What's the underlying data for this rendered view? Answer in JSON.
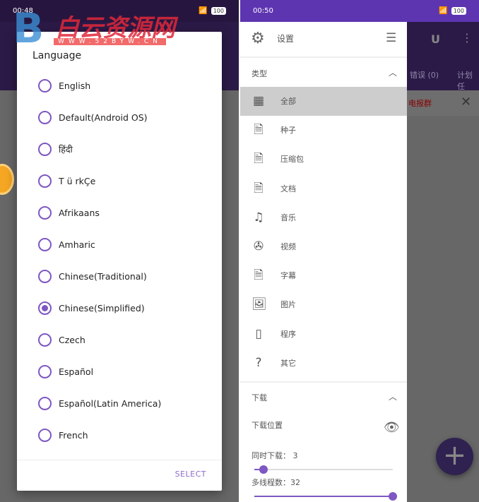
{
  "left": {
    "status": {
      "time": "00:48",
      "battery": "100"
    },
    "watermark": {
      "logo": "B",
      "title": "白云资源网",
      "url": "WWW.52BYW.CN"
    },
    "dialog": {
      "title": "Language",
      "options": [
        {
          "label": "English",
          "selected": false
        },
        {
          "label": "Default(Android OS)",
          "selected": false
        },
        {
          "label": "हिंदी",
          "selected": false
        },
        {
          "label": "T ü rkÇe",
          "selected": false
        },
        {
          "label": "Afrikaans",
          "selected": false
        },
        {
          "label": "Amharic",
          "selected": false
        },
        {
          "label": "Chinese(Traditional)",
          "selected": false
        },
        {
          "label": "Chinese(Simplified)",
          "selected": true
        },
        {
          "label": "Czech",
          "selected": false
        },
        {
          "label": "Español",
          "selected": false
        },
        {
          "label": "Español(Latin America)",
          "selected": false
        },
        {
          "label": "French",
          "selected": false
        }
      ],
      "select_label": "SELECT"
    },
    "accent": "#7e57c2"
  },
  "right": {
    "status": {
      "time": "00:50",
      "battery": "100"
    },
    "background": {
      "tab_error": "错误 (0)",
      "tab_plan": "计划任",
      "notice": "电报群"
    },
    "drawer": {
      "header": {
        "title": "设置"
      },
      "type_section": {
        "title": "类型",
        "items": [
          {
            "label": "全部",
            "icon": "grid-icon",
            "selected": true
          },
          {
            "label": "种子",
            "icon": "torrent-file-icon"
          },
          {
            "label": "压缩包",
            "icon": "zip-file-icon"
          },
          {
            "label": "文档",
            "icon": "doc-file-icon"
          },
          {
            "label": "音乐",
            "icon": "music-icon"
          },
          {
            "label": "视频",
            "icon": "film-reel-icon"
          },
          {
            "label": "字幕",
            "icon": "subtitle-file-icon"
          },
          {
            "label": "图片",
            "icon": "image-icon"
          },
          {
            "label": "程序",
            "icon": "phone-icon"
          },
          {
            "label": "其它",
            "icon": "unknown-file-icon"
          }
        ]
      },
      "download_section": {
        "title": "下载",
        "location_label": "下载位置",
        "concurrent_label": "同时下载： 3",
        "concurrent_value": 3,
        "concurrent_min": 1,
        "concurrent_max": 32,
        "threads_label": "多线程数：32",
        "threads_value": 32,
        "threads_min": 1,
        "threads_max": 32
      }
    },
    "accent": "#5e35b1"
  }
}
